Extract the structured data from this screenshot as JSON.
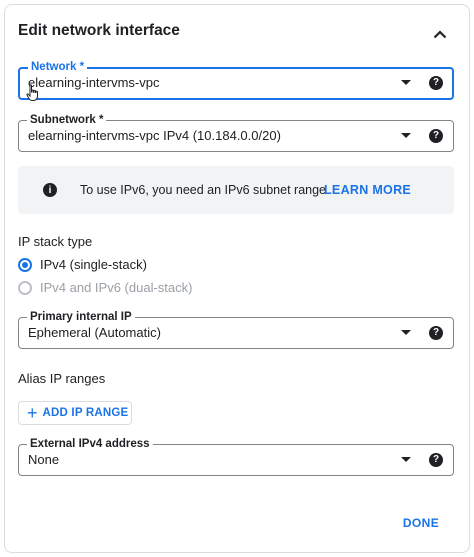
{
  "header": {
    "title": "Edit network interface"
  },
  "network": {
    "label": "Network *",
    "value": "elearning-intervms-vpc",
    "help": "?"
  },
  "subnetwork": {
    "label": "Subnetwork *",
    "value": "elearning-intervms-vpc IPv4 (10.184.0.0/20)",
    "help": "?"
  },
  "info": {
    "icon_glyph": "i",
    "text": "To use IPv6, you need an IPv6 subnet range.",
    "link": "LEARN MORE"
  },
  "ip_stack": {
    "title": "IP stack type",
    "options": [
      {
        "label": "IPv4 (single-stack)",
        "selected": true,
        "disabled": false
      },
      {
        "label": "IPv4 and IPv6 (dual-stack)",
        "selected": false,
        "disabled": true
      }
    ]
  },
  "primary_ip": {
    "label": "Primary internal IP",
    "value": "Ephemeral (Automatic)",
    "help": "?"
  },
  "alias": {
    "title": "Alias IP ranges",
    "button_icon": "+",
    "button_label": "ADD IP RANGE"
  },
  "external_ip": {
    "label": "External IPv4 address",
    "value": "None",
    "help": "?"
  },
  "footer": {
    "done_label": "DONE"
  },
  "colors": {
    "accent": "#1a73e8",
    "text": "#202124",
    "info_bg": "#f1f3f4",
    "border": "#80868b"
  },
  "icons": [
    "chevron-up-icon",
    "dropdown-arrow-icon",
    "help-icon",
    "info-icon",
    "plus-icon",
    "hand-cursor-icon"
  ]
}
